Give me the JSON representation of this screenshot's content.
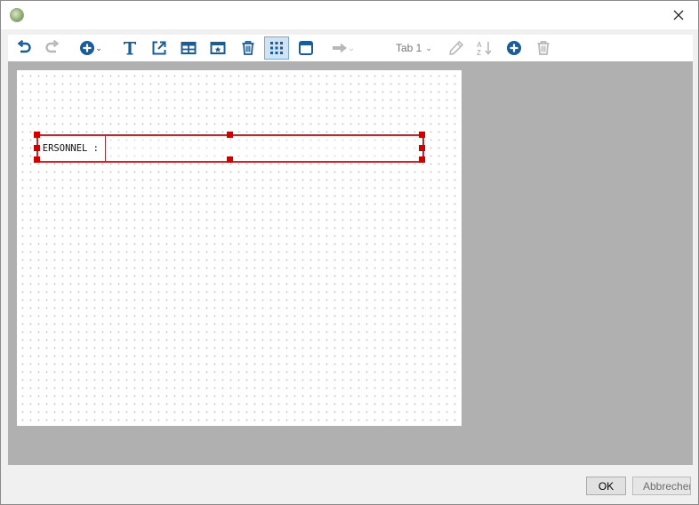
{
  "window": {
    "app_icon": "app-logo-icon",
    "close_icon": "close-icon"
  },
  "toolbar": {
    "icons": [
      "undo-icon",
      "redo-icon",
      "add-circle-icon",
      "text-icon",
      "external-link-icon",
      "table-icon",
      "image-icon",
      "trash-icon",
      "grid-icon",
      "panel-icon",
      "arrow-right-icon",
      "sort-az-icon",
      "add-tab-icon",
      "delete-tab-icon"
    ],
    "tab_label": "Tab 1",
    "active_button": "grid-toggle-button"
  },
  "form": {
    "field_label": "ERSONNEL :",
    "field_value": ""
  },
  "footer": {
    "ok_label": "OK",
    "cancel_label": "Abbrechen"
  },
  "colors": {
    "accent": "#1a5c96",
    "selection": "#c62828",
    "canvas_bg": "#b0b0b0",
    "disabled": "#b8b8b8"
  }
}
